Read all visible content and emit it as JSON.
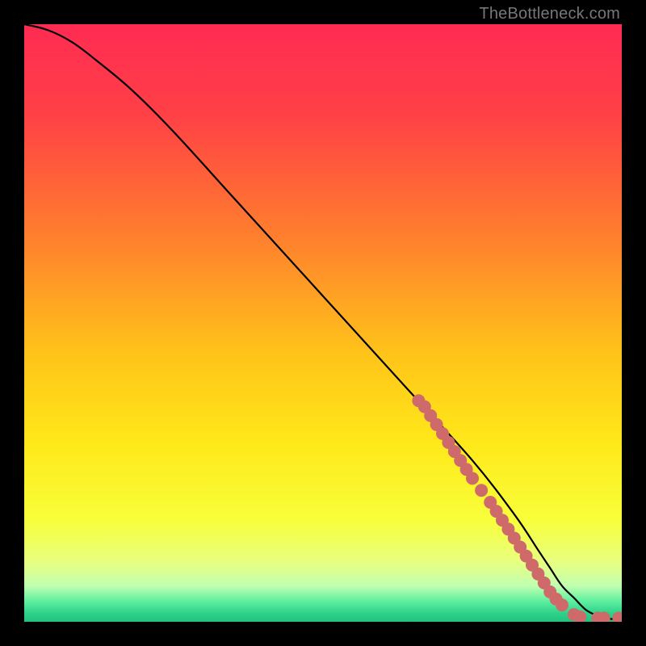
{
  "attribution": "TheBottleneck.com",
  "colors": {
    "background": "#000000",
    "gradient_stops": [
      {
        "offset": 0.0,
        "color": "#ff2b53"
      },
      {
        "offset": 0.15,
        "color": "#ff4046"
      },
      {
        "offset": 0.35,
        "color": "#ff7d2e"
      },
      {
        "offset": 0.55,
        "color": "#ffc31a"
      },
      {
        "offset": 0.7,
        "color": "#ffe81a"
      },
      {
        "offset": 0.83,
        "color": "#f8ff3a"
      },
      {
        "offset": 0.9,
        "color": "#e8ff80"
      },
      {
        "offset": 0.94,
        "color": "#c0ffb0"
      },
      {
        "offset": 0.965,
        "color": "#60f0a0"
      },
      {
        "offset": 0.985,
        "color": "#2fd28a"
      },
      {
        "offset": 1.0,
        "color": "#22c27c"
      }
    ],
    "curve": "#000000",
    "markers_fill": "#cf6a6a",
    "markers_stroke": "#8f3a3a",
    "attribution_text": "#777777"
  },
  "chart_data": {
    "type": "line",
    "title": "",
    "xlabel": "",
    "ylabel": "",
    "xlim": [
      0,
      100
    ],
    "ylim": [
      0,
      100
    ],
    "series": [
      {
        "name": "bottleneck-curve",
        "x": [
          0,
          4,
          8,
          12,
          18,
          25,
          35,
          45,
          55,
          65,
          75,
          82,
          86,
          88,
          90,
          92,
          94,
          96,
          98,
          100
        ],
        "y": [
          100,
          99,
          97,
          94,
          89,
          82,
          71,
          60,
          49,
          38,
          27,
          18,
          12,
          9,
          6,
          4,
          2,
          1,
          0.5,
          0.5
        ]
      }
    ],
    "markers": {
      "name": "dense-segment",
      "points": [
        {
          "x": 66,
          "y": 37
        },
        {
          "x": 67,
          "y": 36
        },
        {
          "x": 68,
          "y": 34.5
        },
        {
          "x": 69,
          "y": 33
        },
        {
          "x": 70,
          "y": 31.5
        },
        {
          "x": 71,
          "y": 30
        },
        {
          "x": 72,
          "y": 28.5
        },
        {
          "x": 73,
          "y": 27
        },
        {
          "x": 74,
          "y": 25.5
        },
        {
          "x": 75,
          "y": 24
        },
        {
          "x": 76.5,
          "y": 22
        },
        {
          "x": 78,
          "y": 20
        },
        {
          "x": 79,
          "y": 18.5
        },
        {
          "x": 80,
          "y": 17
        },
        {
          "x": 81,
          "y": 15.5
        },
        {
          "x": 82,
          "y": 14
        },
        {
          "x": 83,
          "y": 12.5
        },
        {
          "x": 84,
          "y": 11
        },
        {
          "x": 85,
          "y": 9.5
        },
        {
          "x": 86,
          "y": 8
        },
        {
          "x": 87,
          "y": 6.5
        },
        {
          "x": 88,
          "y": 5
        },
        {
          "x": 89,
          "y": 3.8
        },
        {
          "x": 90,
          "y": 2.8
        },
        {
          "x": 92,
          "y": 1.2
        },
        {
          "x": 93,
          "y": 0.8
        },
        {
          "x": 96,
          "y": 0.6
        },
        {
          "x": 97,
          "y": 0.6
        },
        {
          "x": 99.5,
          "y": 0.6
        }
      ]
    }
  }
}
